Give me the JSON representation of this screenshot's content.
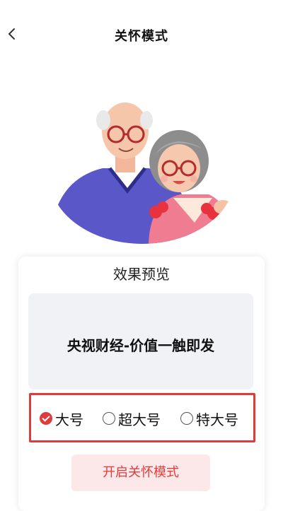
{
  "header": {
    "title": "关怀模式",
    "back_icon": "chevron-left-icon"
  },
  "illustration": {
    "name": "elderly-couple-illustration"
  },
  "preview": {
    "section_title": "效果预览",
    "sample_text": "央视财经-价值一触即发"
  },
  "font_sizes": {
    "selected": "large",
    "options": [
      {
        "id": "large",
        "label": "大号",
        "checked": true
      },
      {
        "id": "extra-large",
        "label": "超大号",
        "checked": false
      },
      {
        "id": "super-large",
        "label": "特大号",
        "checked": false
      }
    ]
  },
  "enable_button": {
    "label": "开启关怀模式"
  },
  "colors": {
    "accent": "#e03a3a",
    "button_bg": "#fce8e8",
    "preview_bg": "#f1f2f6"
  }
}
